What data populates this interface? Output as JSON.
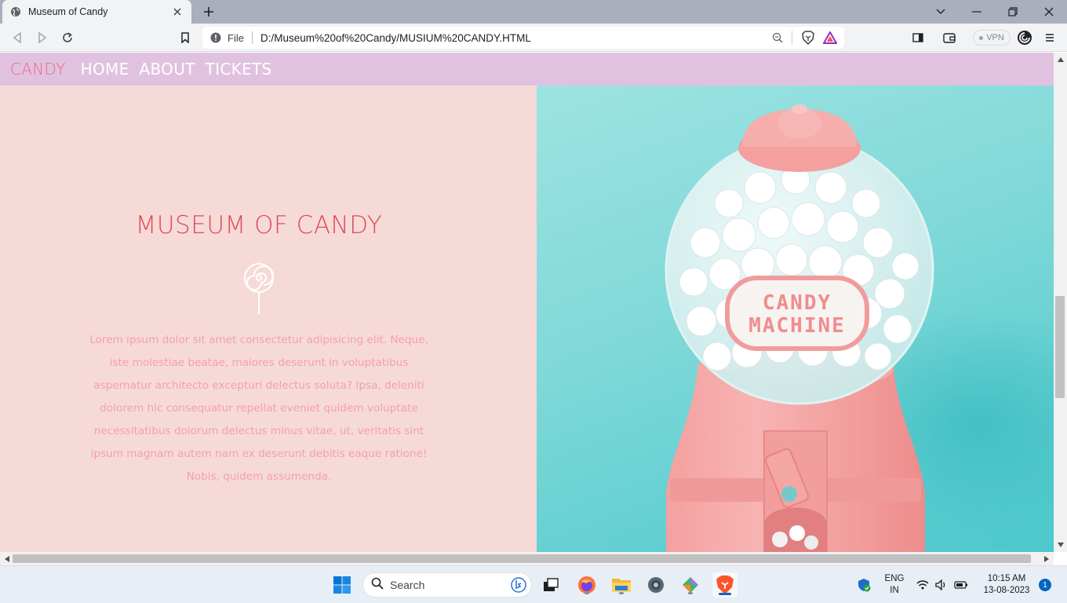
{
  "browser": {
    "tab_title": "Museum of Candy",
    "address_scheme": "File",
    "address_url": "D:/Museum%20of%20Candy/MUSIUM%20CANDY.HTML",
    "vpn_label": "VPN"
  },
  "site": {
    "brand": "CANDY",
    "nav": [
      "HOME",
      "ABOUT",
      "TICKETS"
    ],
    "hero_title": "MUSEUM OF CANDY",
    "hero_text": "Lorem ipsum dolor sit amet consectetur adipisicing elit. Neque, iste molestiae beatae, maiores deserunt in voluptatibus aspernatur architecto excepturi delectus soluta? Ipsa, deleniti dolorem hic consequatur repellat eveniet quidem voluptate necessitatibus dolorum delectus minus vitae, ut, veritatis sint ipsum magnam autem nam ex deserunt debitis eaque ratione! Nobis, quidem assumenda.",
    "machine_label_line1": "CANDY",
    "machine_label_line2": "MACHINE"
  },
  "taskbar": {
    "search_label": "Search",
    "lang_line1": "ENG",
    "lang_line2": "IN",
    "time": "10:15 AM",
    "date": "13-08-2023",
    "notification_count": "1"
  },
  "colors": {
    "nav_bg": "#e0c2e0",
    "brand": "#f0688a",
    "hero_left_bg": "#f6dad8",
    "hero_title": "#e24a56",
    "hero_text": "#f3a0ad",
    "hero_right_bg": "#7fd8d8"
  }
}
